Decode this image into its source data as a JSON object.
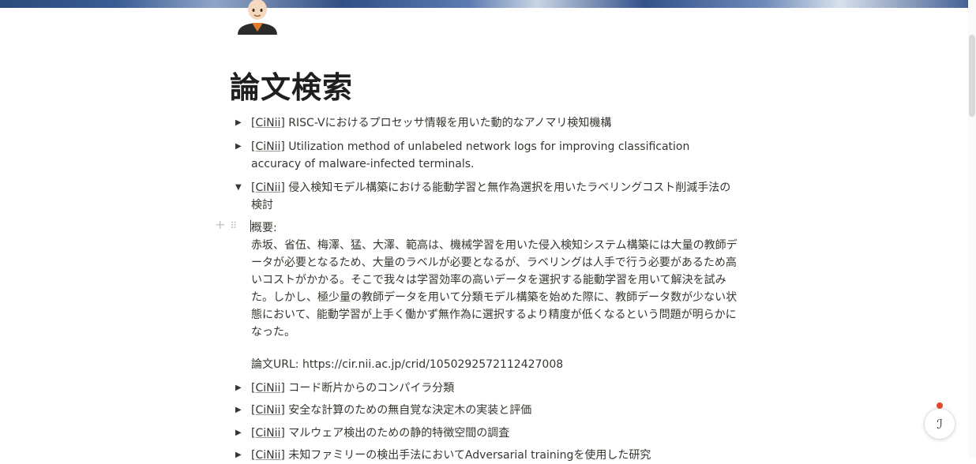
{
  "page": {
    "title": "論文検索"
  },
  "avatar": {
    "icon": "person-avatar-icon"
  },
  "toggles": [
    {
      "source": "[CiNii]",
      "title": " RISC-Vにおけるプロセッサ情報を用いた動的なアノマリ検知機構",
      "expanded": false
    },
    {
      "source": "[CiNii]",
      "title": " Utilization method of unlabeled network logs for improving classification accuracy of malware-infected terminals.",
      "expanded": false
    },
    {
      "source": "[CiNii]",
      "title": " 侵入検知モデル構築における能動学習と無作為選択を用いたラベリングコスト削減手法の検討",
      "expanded": true
    },
    {
      "source": "[CiNii]",
      "title": " コード断片からのコンパイラ分類",
      "expanded": false
    },
    {
      "source": "[CiNii]",
      "title": " 安全な計算のための無自覚な決定木の実装と評価",
      "expanded": false
    },
    {
      "source": "[CiNii]",
      "title": " マルウェア検出のための静的特徴空間の調査",
      "expanded": false
    },
    {
      "source": "[CiNii]",
      "title": " 未知ファミリーの検出手法においてAdversarial trainingを使用した研究",
      "expanded": false
    }
  ],
  "icons": {
    "collapsed": "▶",
    "expanded": "▼",
    "add": "+",
    "drag": "⠿",
    "helper": "ℐ"
  },
  "detail": {
    "summary_label": "概要:",
    "summary_text": "赤坂、省伍、梅澤、猛、大澤、範高は、機械学習を用いた侵入検知システム構築には大量の教師データが必要となるため、大量のラベルが必要となるが、ラベリングは人手で行う必要があるため高いコストがかかる。そこで我々は学習効率の高いデータを選択する能動学習を用いて解決を試みた。しかし、極少量の教師データを用いて分類モデル構築を始めた際に、教師データ数が少ない状態において、能動学習が上手く働かず無作為に選択するより精度が低くなるという問題が明らかになった。",
    "url_label": "論文URL: https://cir.nii.ac.jp/crid/1050292572112427008"
  },
  "colors": {
    "text": "#37352f",
    "cover": "#3a5d94",
    "helper_accent": "#e04b2d"
  }
}
